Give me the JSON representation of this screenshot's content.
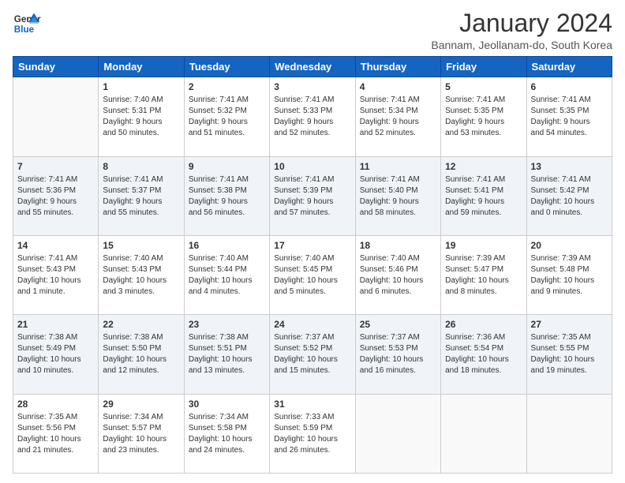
{
  "logo": {
    "line1": "General",
    "line2": "Blue"
  },
  "title": "January 2024",
  "subtitle": "Bannam, Jeollanam-do, South Korea",
  "days_header": [
    "Sunday",
    "Monday",
    "Tuesday",
    "Wednesday",
    "Thursday",
    "Friday",
    "Saturday"
  ],
  "weeks": [
    [
      {
        "day": "",
        "info": ""
      },
      {
        "day": "1",
        "info": "Sunrise: 7:40 AM\nSunset: 5:31 PM\nDaylight: 9 hours\nand 50 minutes."
      },
      {
        "day": "2",
        "info": "Sunrise: 7:41 AM\nSunset: 5:32 PM\nDaylight: 9 hours\nand 51 minutes."
      },
      {
        "day": "3",
        "info": "Sunrise: 7:41 AM\nSunset: 5:33 PM\nDaylight: 9 hours\nand 52 minutes."
      },
      {
        "day": "4",
        "info": "Sunrise: 7:41 AM\nSunset: 5:34 PM\nDaylight: 9 hours\nand 52 minutes."
      },
      {
        "day": "5",
        "info": "Sunrise: 7:41 AM\nSunset: 5:35 PM\nDaylight: 9 hours\nand 53 minutes."
      },
      {
        "day": "6",
        "info": "Sunrise: 7:41 AM\nSunset: 5:35 PM\nDaylight: 9 hours\nand 54 minutes."
      }
    ],
    [
      {
        "day": "7",
        "info": "Sunrise: 7:41 AM\nSunset: 5:36 PM\nDaylight: 9 hours\nand 55 minutes."
      },
      {
        "day": "8",
        "info": "Sunrise: 7:41 AM\nSunset: 5:37 PM\nDaylight: 9 hours\nand 55 minutes."
      },
      {
        "day": "9",
        "info": "Sunrise: 7:41 AM\nSunset: 5:38 PM\nDaylight: 9 hours\nand 56 minutes."
      },
      {
        "day": "10",
        "info": "Sunrise: 7:41 AM\nSunset: 5:39 PM\nDaylight: 9 hours\nand 57 minutes."
      },
      {
        "day": "11",
        "info": "Sunrise: 7:41 AM\nSunset: 5:40 PM\nDaylight: 9 hours\nand 58 minutes."
      },
      {
        "day": "12",
        "info": "Sunrise: 7:41 AM\nSunset: 5:41 PM\nDaylight: 9 hours\nand 59 minutes."
      },
      {
        "day": "13",
        "info": "Sunrise: 7:41 AM\nSunset: 5:42 PM\nDaylight: 10 hours\nand 0 minutes."
      }
    ],
    [
      {
        "day": "14",
        "info": "Sunrise: 7:41 AM\nSunset: 5:43 PM\nDaylight: 10 hours\nand 1 minute."
      },
      {
        "day": "15",
        "info": "Sunrise: 7:40 AM\nSunset: 5:43 PM\nDaylight: 10 hours\nand 3 minutes."
      },
      {
        "day": "16",
        "info": "Sunrise: 7:40 AM\nSunset: 5:44 PM\nDaylight: 10 hours\nand 4 minutes."
      },
      {
        "day": "17",
        "info": "Sunrise: 7:40 AM\nSunset: 5:45 PM\nDaylight: 10 hours\nand 5 minutes."
      },
      {
        "day": "18",
        "info": "Sunrise: 7:40 AM\nSunset: 5:46 PM\nDaylight: 10 hours\nand 6 minutes."
      },
      {
        "day": "19",
        "info": "Sunrise: 7:39 AM\nSunset: 5:47 PM\nDaylight: 10 hours\nand 8 minutes."
      },
      {
        "day": "20",
        "info": "Sunrise: 7:39 AM\nSunset: 5:48 PM\nDaylight: 10 hours\nand 9 minutes."
      }
    ],
    [
      {
        "day": "21",
        "info": "Sunrise: 7:38 AM\nSunset: 5:49 PM\nDaylight: 10 hours\nand 10 minutes."
      },
      {
        "day": "22",
        "info": "Sunrise: 7:38 AM\nSunset: 5:50 PM\nDaylight: 10 hours\nand 12 minutes."
      },
      {
        "day": "23",
        "info": "Sunrise: 7:38 AM\nSunset: 5:51 PM\nDaylight: 10 hours\nand 13 minutes."
      },
      {
        "day": "24",
        "info": "Sunrise: 7:37 AM\nSunset: 5:52 PM\nDaylight: 10 hours\nand 15 minutes."
      },
      {
        "day": "25",
        "info": "Sunrise: 7:37 AM\nSunset: 5:53 PM\nDaylight: 10 hours\nand 16 minutes."
      },
      {
        "day": "26",
        "info": "Sunrise: 7:36 AM\nSunset: 5:54 PM\nDaylight: 10 hours\nand 18 minutes."
      },
      {
        "day": "27",
        "info": "Sunrise: 7:35 AM\nSunset: 5:55 PM\nDaylight: 10 hours\nand 19 minutes."
      }
    ],
    [
      {
        "day": "28",
        "info": "Sunrise: 7:35 AM\nSunset: 5:56 PM\nDaylight: 10 hours\nand 21 minutes."
      },
      {
        "day": "29",
        "info": "Sunrise: 7:34 AM\nSunset: 5:57 PM\nDaylight: 10 hours\nand 23 minutes."
      },
      {
        "day": "30",
        "info": "Sunrise: 7:34 AM\nSunset: 5:58 PM\nDaylight: 10 hours\nand 24 minutes."
      },
      {
        "day": "31",
        "info": "Sunrise: 7:33 AM\nSunset: 5:59 PM\nDaylight: 10 hours\nand 26 minutes."
      },
      {
        "day": "",
        "info": ""
      },
      {
        "day": "",
        "info": ""
      },
      {
        "day": "",
        "info": ""
      }
    ]
  ]
}
